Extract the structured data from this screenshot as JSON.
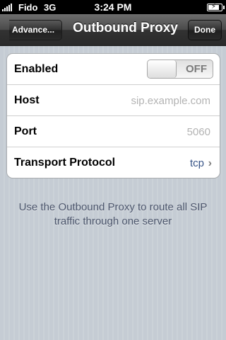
{
  "status_bar": {
    "carrier": "Fido",
    "network": "3G",
    "time": "3:24 PM",
    "battery_icon": "battery-charging-icon",
    "signal_icon": "signal-bars-icon"
  },
  "nav": {
    "back_label": "Advance...",
    "title": "Outbound Proxy",
    "done_label": "Done"
  },
  "settings": {
    "enabled": {
      "label": "Enabled",
      "toggle_text": "OFF",
      "value": false
    },
    "host": {
      "label": "Host",
      "placeholder": "sip.example.com"
    },
    "port": {
      "label": "Port",
      "placeholder": "5060"
    },
    "transport": {
      "label": "Transport Protocol",
      "value": "tcp"
    }
  },
  "footer": {
    "note": "Use the Outbound Proxy to route all SIP traffic through one server"
  },
  "colors": {
    "background": "#c5ccd4",
    "nav_bar": "#3a3a3a",
    "link_value": "#385487"
  }
}
